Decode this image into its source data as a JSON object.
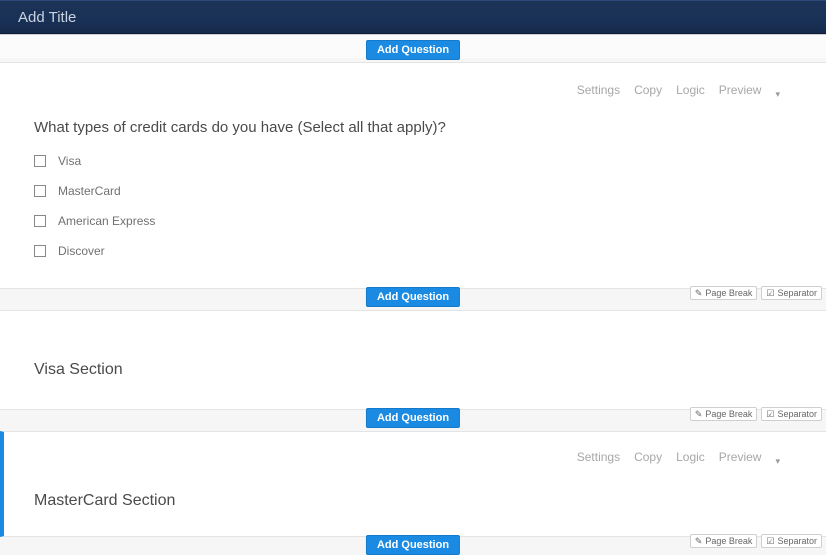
{
  "title_placeholder": "Add Title",
  "buttons": {
    "add_question": "Add Question",
    "page_break": "Page Break",
    "separator": "Separator"
  },
  "toolbar": {
    "settings": "Settings",
    "copy": "Copy",
    "logic": "Logic",
    "preview": "Preview"
  },
  "question1": {
    "text": "What types of credit cards do you have (Select all that apply)?",
    "options": [
      "Visa",
      "MasterCard",
      "American Express",
      "Discover"
    ]
  },
  "section_visa": {
    "title": "Visa Section"
  },
  "section_master": {
    "title": "MasterCard Section"
  }
}
